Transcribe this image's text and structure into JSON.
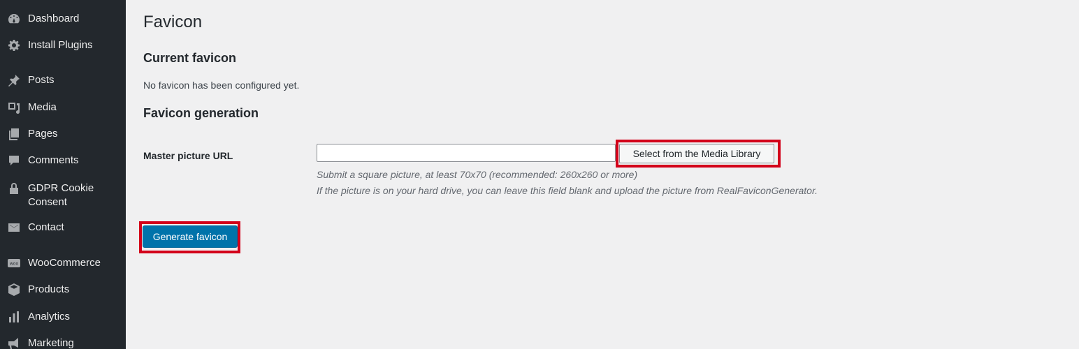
{
  "sidebar": {
    "items": [
      {
        "label": "Dashboard",
        "icon": "dashboard-icon"
      },
      {
        "label": "Install Plugins",
        "icon": "gear-icon"
      },
      {
        "label": "Posts",
        "icon": "pushpin-icon"
      },
      {
        "label": "Media",
        "icon": "media-icon"
      },
      {
        "label": "Pages",
        "icon": "pages-icon"
      },
      {
        "label": "Comments",
        "icon": "comment-icon"
      },
      {
        "label": "GDPR Cookie Consent",
        "icon": "lock-icon"
      },
      {
        "label": "Contact",
        "icon": "envelope-icon"
      },
      {
        "label": "WooCommerce",
        "icon": "woo-icon"
      },
      {
        "label": "Products",
        "icon": "box-icon"
      },
      {
        "label": "Analytics",
        "icon": "bar-chart-icon"
      },
      {
        "label": "Marketing",
        "icon": "megaphone-icon"
      }
    ]
  },
  "main": {
    "title": "Favicon",
    "current_section": {
      "title": "Current favicon",
      "status": "No favicon has been configured yet."
    },
    "generation_section": {
      "title": "Favicon generation",
      "field_label": "Master picture URL",
      "url_value": "",
      "media_button": "Select from the Media Library",
      "hint_line1": "Submit a square picture, at least 70x70 (recommended: 260x260 or more)",
      "hint_line2": "If the picture is on your hard drive, you can leave this field blank and upload the picture from RealFaviconGenerator."
    },
    "generate_button": "Generate favicon"
  },
  "colors": {
    "sidebar_bg": "#23282d",
    "page_bg": "#f0f0f1",
    "primary_button": "#0073aa",
    "highlight": "#d3001a"
  }
}
